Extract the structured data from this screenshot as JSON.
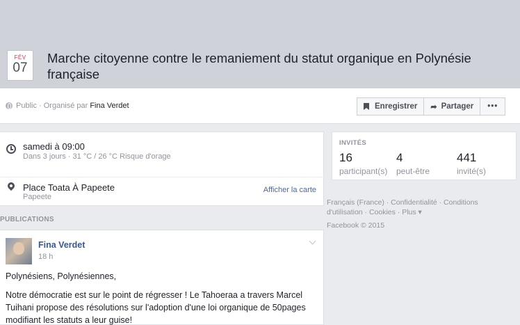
{
  "event": {
    "month": "FÉV",
    "day": "07",
    "title": "Marche citoyenne contre le remaniement du statut organique en Polynésie française"
  },
  "subbar": {
    "privacy": "Public · Organisé par",
    "organizer": "Fina Verdet",
    "buttons": {
      "save": "Enregistrer",
      "share": "Partager",
      "more": "•••"
    }
  },
  "details": {
    "time_main": "samedi à 09:00",
    "time_sub": "Dans 3 jours · 31 °C / 26 °C Risque d'orage",
    "place_main": "Place Toata À Papeete",
    "place_sub": "Papeete",
    "map_link": "Afficher la carte"
  },
  "publications_label": "PUBLICATIONS",
  "post": {
    "author": "Fina Verdet",
    "time": "18 h",
    "greeting": "Polynésiens, Polynésiennes,",
    "body": "Notre démocratie est sur le point de régresser ! Le Tahoeraa a travers Marcel Tuihani propose des résolutions sur l'adoption d'une loi organique de 50pages modifiant les statuts a leur guise!"
  },
  "invites": {
    "title": "INVITÉS",
    "stats": [
      {
        "count": "16",
        "label": "participant(s)"
      },
      {
        "count": "4",
        "label": "peut-être"
      },
      {
        "count": "441",
        "label": "invité(s)"
      }
    ]
  },
  "footer": {
    "links": "Français (France) · Confidentialité · Conditions d'utilisation · Cookies · Plus ▾",
    "copyright": "Facebook © 2015"
  },
  "icons": {
    "privacy": "globe-icon",
    "time": "clock-icon",
    "place": "pin-icon",
    "save": "bookmark-icon",
    "share": "share-arrow-icon",
    "post_menu": "chevron-down-icon"
  },
  "colors": {
    "header_bg": "#cfd3d9",
    "link": "#365899",
    "date_month": "#f02849"
  }
}
